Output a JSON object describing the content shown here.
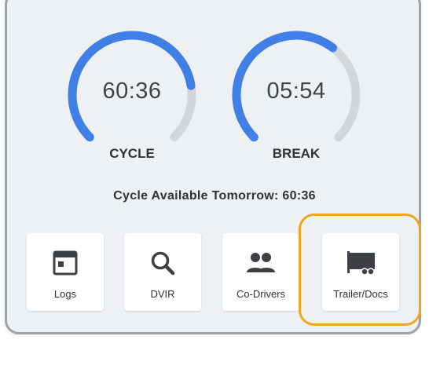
{
  "colors": {
    "gauge_progress": "#3f7fe6",
    "gauge_track": "#d3d7dc",
    "highlight": "#f2a51c",
    "icon": "#3d4146"
  },
  "gauges": [
    {
      "value": "60:36",
      "label": "CYCLE",
      "progress": 0.8
    },
    {
      "value": "05:54",
      "label": "BREAK",
      "progress": 0.64
    }
  ],
  "cycle_available_text": "Cycle Available Tomorrow: 60:36",
  "tiles": [
    {
      "label": "Logs",
      "icon": "calendar-icon"
    },
    {
      "label": "DVIR",
      "icon": "search-icon"
    },
    {
      "label": "Co-Drivers",
      "icon": "people-icon"
    },
    {
      "label": "Trailer/Docs",
      "icon": "trailer-icon"
    }
  ]
}
